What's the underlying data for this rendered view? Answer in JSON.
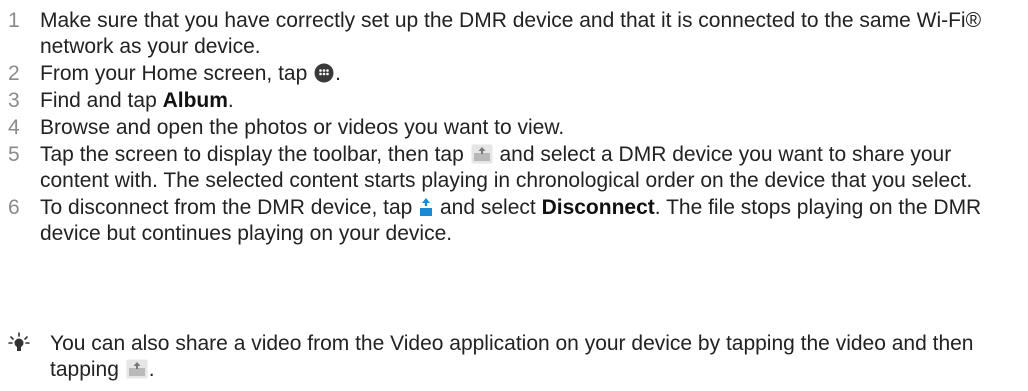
{
  "steps": [
    {
      "number": "1",
      "text": "Make sure that you have correctly set up the DMR device and that it is connected to the same Wi-Fi® network as your device."
    },
    {
      "number": "2",
      "before": "From your Home screen, tap ",
      "icon": "app-grid-icon",
      "after": "."
    },
    {
      "number": "3",
      "before": "Find and tap ",
      "bold": "Album",
      "after": "."
    },
    {
      "number": "4",
      "text": "Browse and open the photos or videos you want to view."
    },
    {
      "number": "5",
      "before": "Tap the screen to display the toolbar, then tap ",
      "icon": "share-device-icon",
      "after": " and select a DMR device you want to share your content with. The selected content starts playing in chronological order on the device that you select."
    },
    {
      "number": "6",
      "before": "To disconnect from the DMR device, tap ",
      "icon": "share-active-icon",
      "middle": " and select ",
      "bold": "Disconnect",
      "after": ". The file stops playing on the DMR device but continues playing on your device."
    }
  ],
  "tip": {
    "icon": "lightbulb-tip-icon",
    "before": "You can also share a video from the Video application on your device by tapping the video and then tapping ",
    "share_icon": "share-device-icon",
    "after": "."
  },
  "colors": {
    "step_number": "#8a8a8a",
    "text": "#222222",
    "active_accent": "#1a8ad4"
  }
}
